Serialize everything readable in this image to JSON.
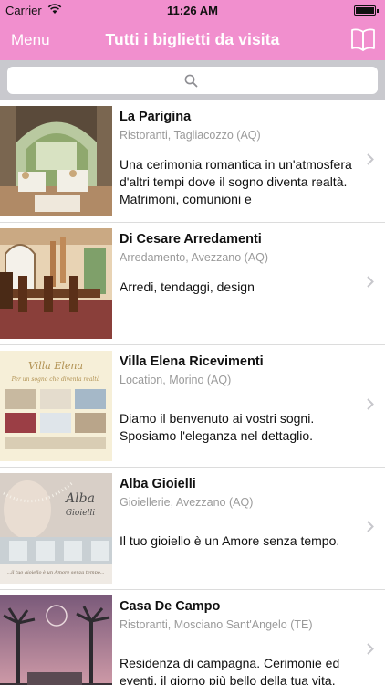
{
  "status_bar": {
    "carrier": "Carrier",
    "time": "11:26 AM"
  },
  "nav": {
    "menu_label": "Menu",
    "title": "Tutti i biglietti da visita"
  },
  "search": {
    "placeholder": ""
  },
  "colors": {
    "accent": "#f18fce",
    "search_bg": "#c9c9ce",
    "separator": "#dcdcdc",
    "subtitle": "#9a9a9a"
  },
  "listings": [
    {
      "name": "La Parigina",
      "category": "Ristoranti, Tagliacozzo (AQ)",
      "description": "Una cerimonia romantica in un'atmosfera d'altri tempi dove il sogno diventa realtà. Matrimoni, comunioni e"
    },
    {
      "name": "Di Cesare Arredamenti",
      "category": "Arredamento, Avezzano (AQ)",
      "description": "Arredi, tendaggi, design"
    },
    {
      "name": "Villa Elena Ricevimenti",
      "category": "Location, Morino (AQ)",
      "description": "Diamo il benvenuto ai vostri sogni. Sposiamo l'eleganza nel dettaglio."
    },
    {
      "name": "Alba Gioielli",
      "category": "Gioiellerie, Avezzano (AQ)",
      "description": "Il tuo gioiello è un Amore senza tempo."
    },
    {
      "name": "Casa De Campo",
      "category": "Ristoranti, Mosciano Sant'Angelo (TE)",
      "description": "Residenza di campagna. Cerimonie ed eventi, il giorno più bello della tua vita."
    }
  ],
  "thumb_text": {
    "villa_logo": "Villa Elena",
    "villa_tagline": "Per un sogno che diventa realtà",
    "alba_logo_1": "Alba",
    "alba_logo_2": "Gioielli",
    "alba_caption": "...il tuo gioiello è un Amore senza tempo..."
  }
}
